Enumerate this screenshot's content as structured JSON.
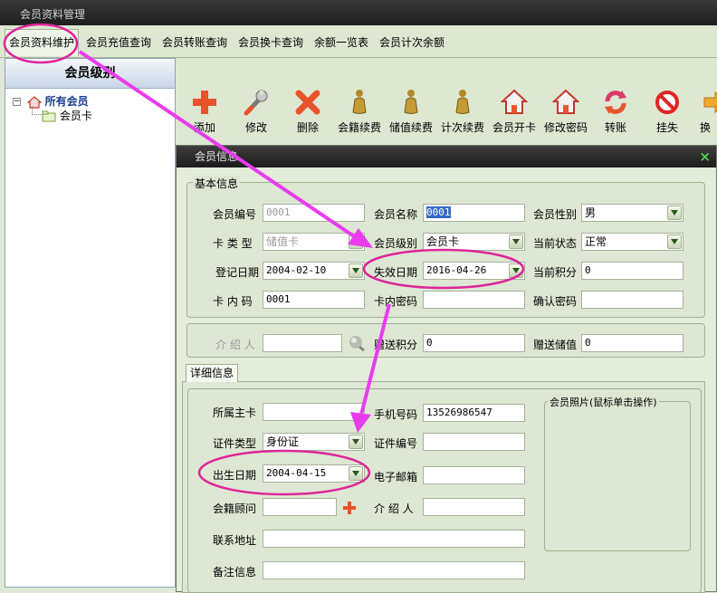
{
  "window": {
    "title": "会员资料管理"
  },
  "tabs": [
    {
      "label": "会员资料维护"
    },
    {
      "label": "会员充值查询"
    },
    {
      "label": "会员转账查询"
    },
    {
      "label": "会员换卡查询"
    },
    {
      "label": "余额一览表"
    },
    {
      "label": "会员计次余额"
    }
  ],
  "left_panel": {
    "header": "会员级别",
    "tree": {
      "root": "所有会员",
      "child": "会员卡",
      "expand_symbol": "−"
    }
  },
  "toolbar": {
    "buttons": [
      {
        "label": "添加",
        "icon": "add-icon"
      },
      {
        "label": "修改",
        "icon": "wrench-icon"
      },
      {
        "label": "删除",
        "icon": "delete-icon"
      },
      {
        "label": "会籍续费",
        "icon": "figure-icon"
      },
      {
        "label": "储值续费",
        "icon": "figure-icon"
      },
      {
        "label": "计次续费",
        "icon": "figure-icon"
      },
      {
        "label": "会员开卡",
        "icon": "house-icon"
      },
      {
        "label": "修改密码",
        "icon": "house-icon"
      },
      {
        "label": "转账",
        "icon": "transfer-icon"
      },
      {
        "label": "挂失",
        "icon": "prohibit-icon"
      },
      {
        "label": "换",
        "icon": "arrow-icon"
      }
    ]
  },
  "dialog": {
    "title": "会员信息",
    "close_symbol": "×",
    "basic_group": "基本信息",
    "basic": {
      "member_no_label": "会员编号",
      "member_no_value": "0001",
      "member_name_label": "会员名称",
      "member_name_value": "0001",
      "gender_label": "会员性别",
      "gender_value": "男",
      "card_type_label": "卡 类 型",
      "card_type_value": "储值卡",
      "level_label": "会员级别",
      "level_value": "会员卡",
      "status_label": "当前状态",
      "status_value": "正常",
      "reg_date_label": "登记日期",
      "reg_date_value": "2004-02-10",
      "expiry_label": "失效日期",
      "expiry_value": "2016-04-26",
      "points_label": "当前积分",
      "points_value": "0",
      "card_code_label": "卡 内 码",
      "card_code_value": "0001",
      "card_pwd_label": "卡内密码",
      "card_pwd_value": "",
      "confirm_pwd_label": "确认密码",
      "confirm_pwd_value": ""
    },
    "referrer": {
      "referrer_label": "介 绍 人",
      "referrer_value": "",
      "bonus_points_label": "赠送积分",
      "bonus_points_value": "0",
      "bonus_balance_label": "赠送储值",
      "bonus_balance_value": "0"
    },
    "detail_tab": "详细信息",
    "detail": {
      "main_card_label": "所属主卡",
      "main_card_value": "",
      "phone_label": "手机号码",
      "phone_value": "13526986547",
      "id_type_label": "证件类型",
      "id_type_value": "身份证",
      "id_no_label": "证件编号",
      "id_no_value": "",
      "birth_label": "出生日期",
      "birth_value": "2004-04-15",
      "email_label": "电子邮箱",
      "email_value": "",
      "advisor_label": "会籍顾问",
      "advisor_value": "",
      "referrer2_label": "介 绍 人",
      "referrer2_value": "",
      "address_label": "联系地址",
      "address_value": "",
      "remark_label": "备注信息",
      "remark_value": "",
      "photo_group": "会员照片(鼠标单击操作)"
    }
  },
  "colors": {
    "annotation": "#e0249a",
    "arrow": "#e93cef"
  }
}
